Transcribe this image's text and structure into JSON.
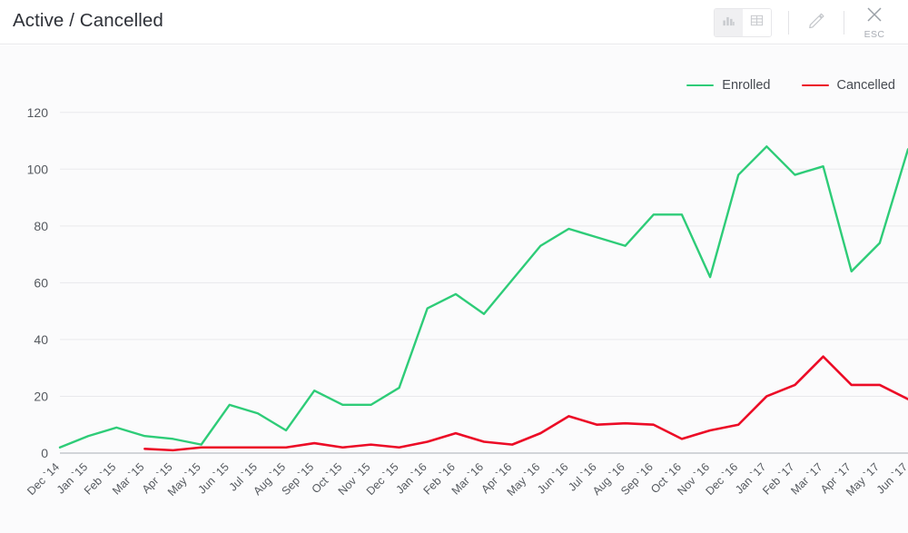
{
  "header": {
    "title": "Active / Cancelled",
    "tools": {
      "chart_view_icon": "bar-chart-icon",
      "table_view_icon": "table-grid-icon",
      "edit_icon": "pencil-icon",
      "close_icon": "close-x-icon",
      "close_shortcut_label": "ESC"
    }
  },
  "colors": {
    "enrolled": "#2ecc78",
    "cancelled": "#ec0b26",
    "grid": "#e9e9ec",
    "axis": "#b9bcc1",
    "text": "#55595f",
    "panel_bg": "#fbfbfc",
    "header_bg": "#ffffff"
  },
  "chart_data": {
    "type": "line",
    "title": "Active / Cancelled",
    "xlabel": "",
    "ylabel": "",
    "ylim": [
      0,
      126
    ],
    "yticks": [
      0,
      20,
      40,
      60,
      80,
      100,
      120
    ],
    "grid": true,
    "legend_position": "top-right",
    "categories": [
      "Dec `14",
      "Jan `15",
      "Feb `15",
      "Mar `15",
      "Apr `15",
      "May `15",
      "Jun `15",
      "Jul `15",
      "Aug `15",
      "Sep `15",
      "Oct `15",
      "Nov `15",
      "Dec `15",
      "Jan `16",
      "Feb `16",
      "Mar `16",
      "Apr `16",
      "May `16",
      "Jun `16",
      "Jul `16",
      "Aug `16",
      "Sep `16",
      "Oct `16",
      "Nov `16",
      "Dec `16",
      "Jan `17",
      "Feb `17",
      "Mar `17",
      "Apr `17",
      "May `17",
      "Jun `17"
    ],
    "series": [
      {
        "name": "Enrolled",
        "color": "#2ecc78",
        "values": [
          2,
          6,
          9,
          6,
          5,
          3,
          17,
          14,
          8,
          22,
          17,
          17,
          23,
          51,
          56,
          49,
          61,
          73,
          79,
          76,
          73,
          84,
          84,
          62,
          98,
          108,
          98,
          101,
          64,
          74,
          107
        ],
        "start_index": 0
      },
      {
        "name": "Cancelled",
        "color": "#ec0b26",
        "values": [
          null,
          null,
          null,
          1.5,
          1,
          2,
          2,
          2,
          2,
          3.5,
          2,
          3,
          2,
          4,
          7,
          4,
          3,
          7,
          13,
          10,
          10.5,
          10,
          5,
          8,
          10,
          20,
          24,
          34,
          24,
          24,
          19
        ],
        "start_index": 3
      }
    ]
  }
}
